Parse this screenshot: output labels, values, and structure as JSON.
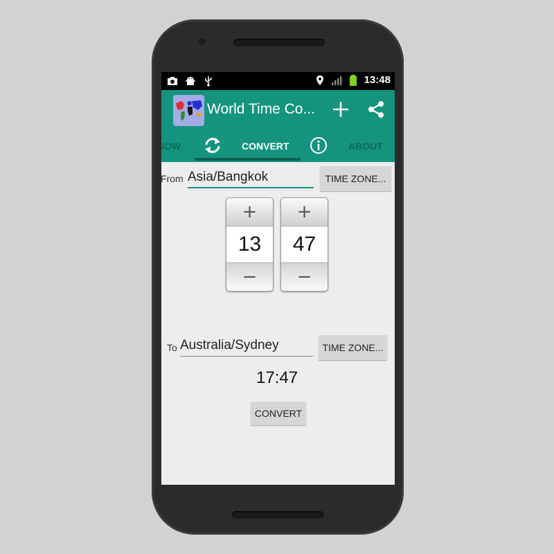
{
  "status_bar": {
    "time": "13:48",
    "icons_left": [
      "camera-icon",
      "android-debug-icon",
      "usb-icon"
    ],
    "icons_right": [
      "location-icon",
      "signal-icon",
      "battery-icon"
    ]
  },
  "app_bar": {
    "title": "World Time Co...",
    "actions": [
      "add-icon",
      "share-icon"
    ],
    "color": "#14947f"
  },
  "tabs": [
    {
      "label": "NOW",
      "selected": false
    },
    {
      "label": "",
      "icon": "refresh-icon"
    },
    {
      "label": "CONVERT",
      "selected": true
    },
    {
      "label": "",
      "icon": "info-icon"
    },
    {
      "label": "ABOUT",
      "selected": false
    }
  ],
  "from": {
    "label": "From",
    "timezone": "Asia/Bangkok",
    "button_label": "TIME ZONE..."
  },
  "time_picker": {
    "hour": "13",
    "minute": "47",
    "increment_symbol": "+",
    "decrement_symbol": "−"
  },
  "to": {
    "label": "To",
    "timezone": "Australia/Sydney",
    "button_label": "TIME ZONE..."
  },
  "result": {
    "time": "17:47"
  },
  "convert_button_label": "CONVERT"
}
